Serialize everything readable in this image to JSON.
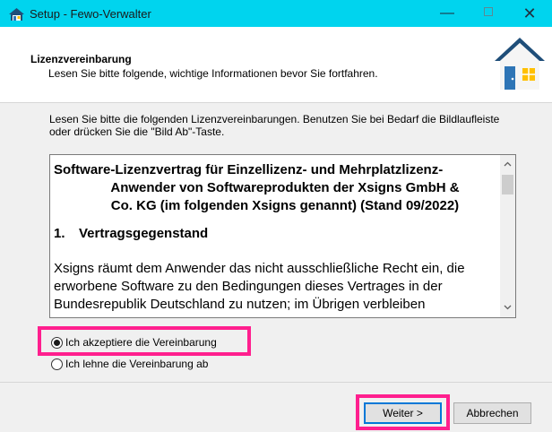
{
  "window": {
    "title": "Setup - Fewo-Verwalter",
    "minimize_glyph": "—",
    "close_glyph": "✕",
    "title_bar_color": "#00d4ee"
  },
  "header": {
    "title": "Lizenzvereinbarung",
    "subtitle": "Lesen Sie bitte folgende, wichtige Informationen bevor Sie fortfahren.",
    "image": "house-icon"
  },
  "intro": "Lesen Sie bitte die folgenden Lizenzvereinbarungen. Benutzen Sie bei Bedarf die Bildlaufleiste oder drücken Sie die \"Bild Ab\"-Taste.",
  "license": {
    "heading_line1": "Software-Lizenzvertrag für Einzellizenz- und Mehrplatzlizenz-",
    "heading_line2": "Anwender von Softwareprodukten der Xsigns GmbH &",
    "heading_line3": "Co. KG (im folgenden Xsigns genannt) (Stand 09/2022)",
    "section_number": "1.",
    "section_title": "Vertragsgegenstand",
    "paragraph": "Xsigns räumt dem Anwender das nicht ausschließliche Recht ein, die erworbene Software zu den Bedingungen dieses Vertrages in der Bundesrepublik Deutschland zu nutzen; im Übrigen verbleiben",
    "scroll_up": "^",
    "scroll_down": "v"
  },
  "options": {
    "accept_label": "Ich akzeptiere die Vereinbarung",
    "decline_label": "Ich lehne die Vereinbarung ab",
    "selected": "accept"
  },
  "buttons": {
    "next_label": "Weiter >",
    "cancel_label": "Abbrechen"
  },
  "colors": {
    "highlight": "#ff1f8e",
    "house_roof": "#1f4e79",
    "house_door": "#2e75b6",
    "house_window": "#ffc000"
  }
}
